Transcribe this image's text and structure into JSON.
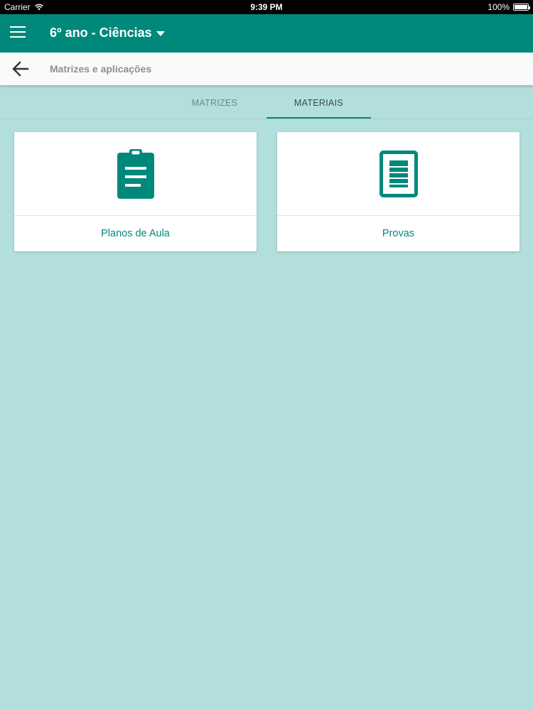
{
  "status_bar": {
    "carrier": "Carrier",
    "time": "9:39 PM",
    "battery": "100%"
  },
  "app_bar": {
    "title": "6º ano - Ciências",
    "menu_icon": "hamburger-menu-icon",
    "dropdown_icon": "caret-down-icon"
  },
  "sub_bar": {
    "title": "Matrizes e aplicações",
    "back_icon": "arrow-back-icon"
  },
  "tabs": [
    {
      "label": "MATRIZES",
      "active": false
    },
    {
      "label": "MATERIAIS",
      "active": true
    }
  ],
  "cards": [
    {
      "label": "Planos de Aula",
      "icon": "clipboard-icon"
    },
    {
      "label": "Provas",
      "icon": "document-icon"
    }
  ],
  "colors": {
    "primary": "#00897b",
    "background": "#b2dfdb",
    "card": "#ffffff"
  }
}
